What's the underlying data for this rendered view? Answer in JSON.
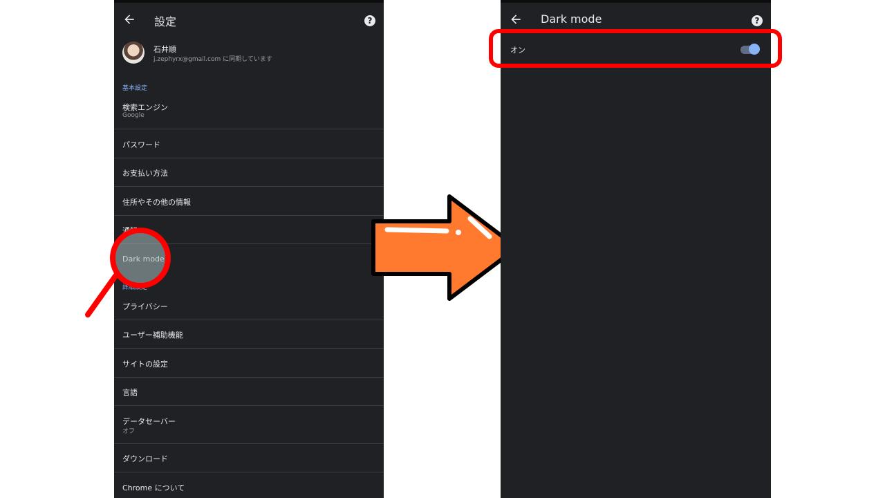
{
  "left": {
    "title": "設定",
    "account": {
      "name": "石井順",
      "email_line": "j.zephyrx@gmail.com に同期しています"
    },
    "sections": [
      {
        "label": "基本設定",
        "items": [
          {
            "label": "検索エンジン",
            "sub": "Google"
          },
          {
            "label": "パスワード"
          },
          {
            "label": "お支払い方法"
          },
          {
            "label": "住所やその他の情報"
          },
          {
            "label": "通知"
          },
          {
            "label": "Dark mode"
          }
        ]
      },
      {
        "label": "詳細設定",
        "items": [
          {
            "label": "プライバシー"
          },
          {
            "label": "ユーザー補助機能"
          },
          {
            "label": "サイトの設定"
          },
          {
            "label": "言語"
          },
          {
            "label": "データセーバー",
            "sub": "オフ"
          },
          {
            "label": "ダウンロード"
          },
          {
            "label": "Chrome について"
          }
        ]
      }
    ],
    "icons": {
      "back": "arrow-left-icon",
      "help": "help-icon"
    }
  },
  "right": {
    "title": "Dark mode",
    "toggle": {
      "label": "オン",
      "state": "on"
    },
    "icons": {
      "back": "arrow-left-icon",
      "help": "help-icon"
    }
  },
  "colors": {
    "screen_bg": "#202124",
    "accent": "#8ab4f8",
    "highlight": "#ff0000",
    "arrow": "#ff7a2f"
  }
}
